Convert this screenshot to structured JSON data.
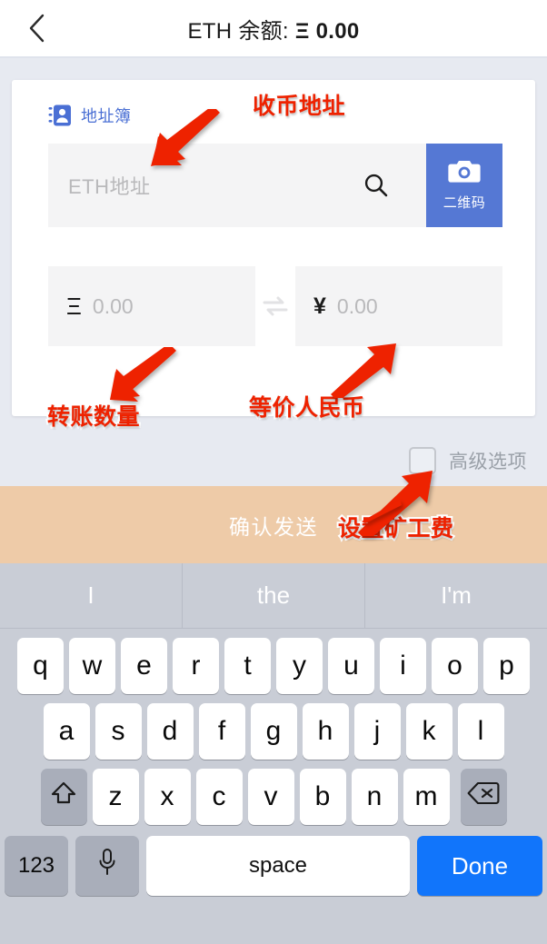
{
  "navbar": {
    "back_icon": "chevron-left-icon",
    "title_prefix": "ETH 余额: ",
    "balance_symbol": "Ξ",
    "balance_value": "0.00"
  },
  "card": {
    "addressbook": {
      "icon": "contact-card-icon",
      "label": "地址簿"
    },
    "address_field": {
      "placeholder": "ETH地址",
      "value": "",
      "search_icon": "search-icon"
    },
    "qr_button": {
      "icon": "camera-icon",
      "label": "二维码",
      "color": "#5578d4"
    },
    "amount_eth": {
      "symbol": "Ξ",
      "placeholder": "0.00",
      "value": ""
    },
    "swap_icon": "swap-horizontal-icon",
    "amount_cny": {
      "symbol": "¥",
      "placeholder": "0.00",
      "value": ""
    }
  },
  "advanced": {
    "checked": false,
    "label": "高级选项"
  },
  "send_button": {
    "label": "确认发送",
    "color": "#eecba8"
  },
  "annotations": [
    {
      "text": "收币地址"
    },
    {
      "text": "转账数量"
    },
    {
      "text": "等价人民币"
    },
    {
      "text": "设置矿工费"
    }
  ],
  "keyboard": {
    "suggestions": [
      "I",
      "the",
      "I'm"
    ],
    "row1": [
      "q",
      "w",
      "e",
      "r",
      "t",
      "y",
      "u",
      "i",
      "o",
      "p"
    ],
    "row2": [
      "a",
      "s",
      "d",
      "f",
      "g",
      "h",
      "j",
      "k",
      "l"
    ],
    "row3": [
      "z",
      "x",
      "c",
      "v",
      "b",
      "n",
      "m"
    ],
    "shift_icon": "shift-up-arrow-icon",
    "backspace_icon": "backspace-delete-icon",
    "num_key": "123",
    "mic_icon": "microphone-icon",
    "space_key": "space",
    "done_key": "Done"
  }
}
